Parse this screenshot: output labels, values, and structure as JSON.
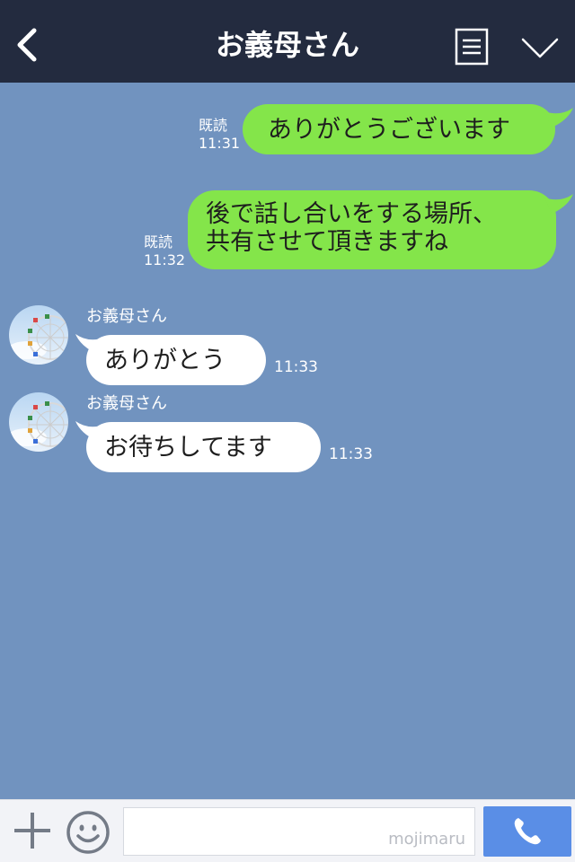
{
  "header": {
    "title": "お義母さん",
    "back_icon": "chevron-left-icon",
    "menu_icon": "list-icon",
    "expand_icon": "chevron-down-icon",
    "background_color": "#232b3f"
  },
  "chat": {
    "background_color": "#7193bf",
    "sent_bubble_color": "#84e54a",
    "received_bubble_color": "#ffffff",
    "messages": [
      {
        "direction": "sent",
        "text": "ありがとうございます",
        "read_label": "既読",
        "time": "11:31"
      },
      {
        "direction": "sent",
        "lines": [
          "後で話し合いをする場所、",
          "共有させて頂きますね"
        ],
        "read_label": "既読",
        "time": "11:32"
      },
      {
        "direction": "received",
        "sender": "お義母さん",
        "text": "ありがとう",
        "time": "11:33"
      },
      {
        "direction": "received",
        "sender": "お義母さん",
        "text": "お待ちしてます",
        "time": "11:33"
      }
    ]
  },
  "input_bar": {
    "plus_icon": "plus-icon",
    "emoji_icon": "emoji-icon",
    "placeholder": "",
    "watermark": "mojimaru",
    "call_icon": "phone-icon",
    "call_button_color": "#5a8ee6"
  }
}
